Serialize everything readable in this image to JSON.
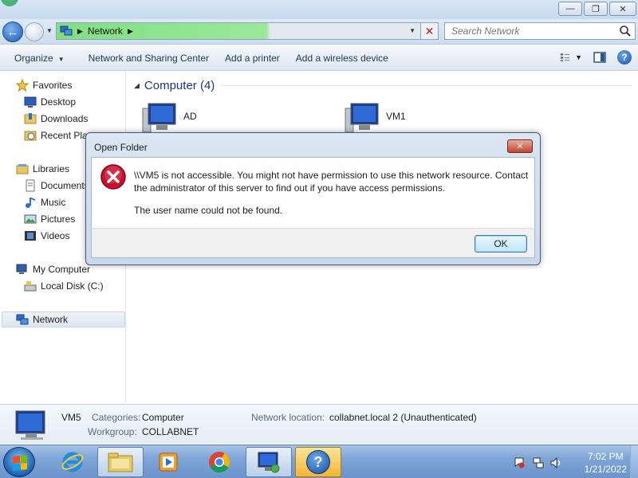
{
  "window": {
    "minimize_glyph": "—",
    "maximize_glyph": "❐",
    "close_glyph": "✕"
  },
  "navbar": {
    "back_glyph": "←",
    "breadcrumb": [
      "Network"
    ],
    "search_placeholder": "Search Network",
    "stop_glyph": "✕"
  },
  "commands": {
    "organize": "Organize",
    "network_sharing": "Network and Sharing Center",
    "add_printer": "Add a printer",
    "add_wireless": "Add a wireless device",
    "help_glyph": "?"
  },
  "sidebar": {
    "favorites": "Favorites",
    "desktop": "Desktop",
    "downloads": "Downloads",
    "recent_places": "Recent Places",
    "libraries": "Libraries",
    "documents": "Documents",
    "music": "Music",
    "pictures": "Pictures",
    "videos": "Videos",
    "my_computer": "My Computer",
    "local_disk": "Local Disk (C:)",
    "network": "Network"
  },
  "main": {
    "group_title": "Computer (4)",
    "computers": [
      "AD",
      "VM1"
    ]
  },
  "dialog": {
    "title": "Open Folder",
    "close_glyph": "✕",
    "message_line1": "\\\\VM5 is not accessible. You might not have permission to use this network resource. Contact",
    "message_line2": "the administrator of this server to find out if you have access permissions.",
    "message_detail": "The user name could not be found.",
    "ok_label": "OK"
  },
  "details": {
    "name": "VM5",
    "categories_key": "Categories:",
    "categories_value": "Computer",
    "workgroup_key": "Workgroup:",
    "workgroup_value": "COLLABNET",
    "network_location_key": "Network location:",
    "network_location_value": "collabnet.local  2 (Unauthenticated)"
  },
  "taskbar": {
    "time": "7:02 PM",
    "date": "1/21/2022",
    "help_glyph": "?"
  },
  "colors": {
    "accent": "#1e3287",
    "address_progress": "#7fe07f",
    "error_red": "#c8102e"
  }
}
